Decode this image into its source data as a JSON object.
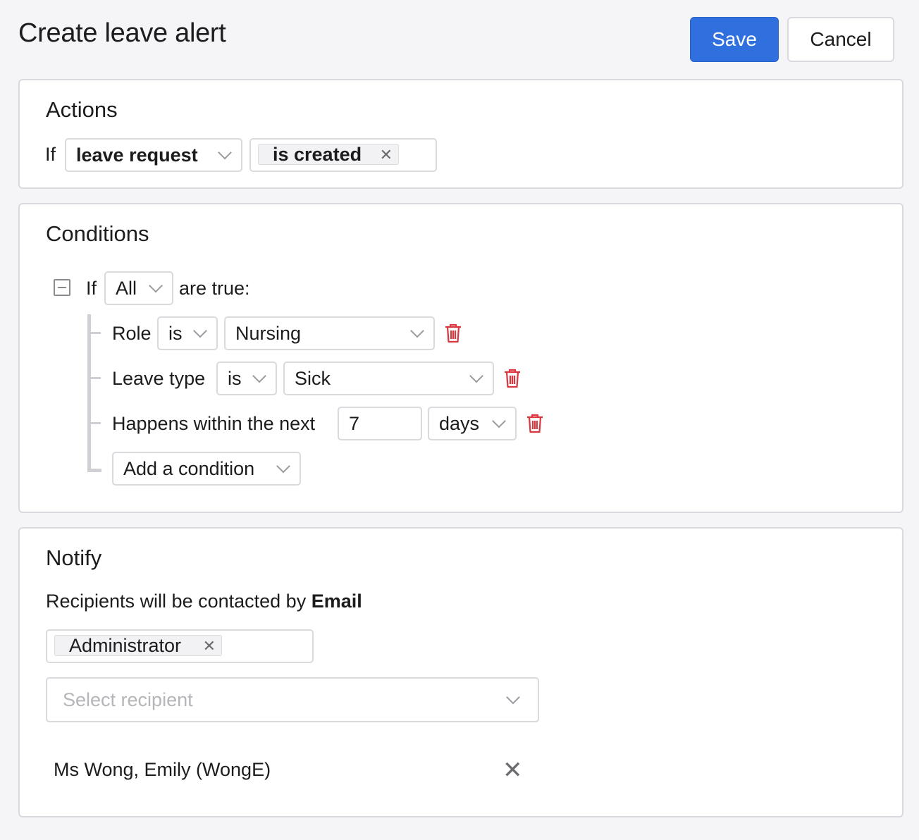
{
  "page": {
    "title": "Create leave alert"
  },
  "toolbar": {
    "save_label": "Save",
    "cancel_label": "Cancel"
  },
  "actions": {
    "heading": "Actions",
    "if_label": "If",
    "subject_select": "leave request",
    "event_tag": "is created"
  },
  "conditions": {
    "heading": "Conditions",
    "if_label": "If",
    "quantifier_select": "All",
    "are_true_label": "are true:",
    "rules": [
      {
        "field": "Role",
        "operator": "is",
        "value": "Nursing"
      },
      {
        "field": "Leave type",
        "operator": "is",
        "value": "Sick"
      },
      {
        "field": "Happens within the next",
        "value": "7",
        "unit": "days"
      }
    ],
    "add_condition_label": "Add a condition"
  },
  "notify": {
    "heading": "Notify",
    "contact_prefix": "Recipients will be contacted by",
    "contact_method": "Email",
    "recipient_tag": "Administrator",
    "select_placeholder": "Select recipient",
    "recipient_entry": "Ms Wong, Emily (WongE)"
  },
  "colors": {
    "primary": "#2f6fde",
    "danger": "#d9363e",
    "border": "#d9d9de"
  }
}
